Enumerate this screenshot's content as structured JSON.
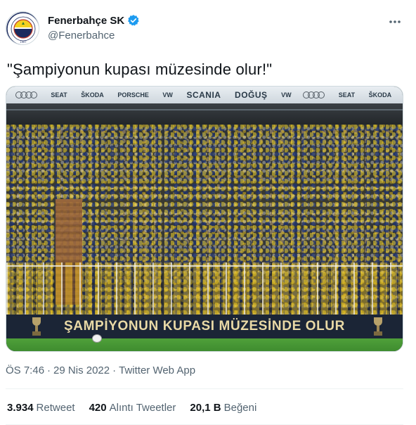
{
  "author": {
    "display_name": "Fenerbahçe SK",
    "handle": "@Fenerbahce",
    "verified": true,
    "avatar_text_top": "FENERBAHÇE SPOR KULÜBÜ",
    "avatar_year": "1907"
  },
  "tweet": {
    "text": "\"Şampiyonun kupası müzesinde olur!\""
  },
  "media": {
    "sponsors": [
      "SEAT",
      "ŠKODA",
      "PORSCHE",
      "VW",
      "SCANIA",
      "DOĞUŞ",
      "VW",
      "SEAT",
      "ŠKODA"
    ],
    "banner_text": "ŞAMPİYONUN KUPASI MÜZESİNDE OLUR"
  },
  "meta": {
    "time": "ÖS 7:46",
    "separator": "·",
    "date": "29 Nis 2022",
    "source": "Twitter Web App"
  },
  "stats": {
    "retweets": {
      "count": "3.934",
      "label": "Retweet"
    },
    "quotes": {
      "count": "420",
      "label": "Alıntı Tweetler"
    },
    "likes": {
      "count": "20,1 B",
      "label": "Beğeni"
    }
  },
  "colors": {
    "text_primary": "#0f1419",
    "text_secondary": "#536471",
    "verified_blue": "#1d9bf0",
    "fb_navy": "#1b2a5e",
    "fb_yellow": "#f4d01f"
  },
  "icons": {
    "verified": "verified-badge-icon",
    "more": "more-options-icon"
  }
}
